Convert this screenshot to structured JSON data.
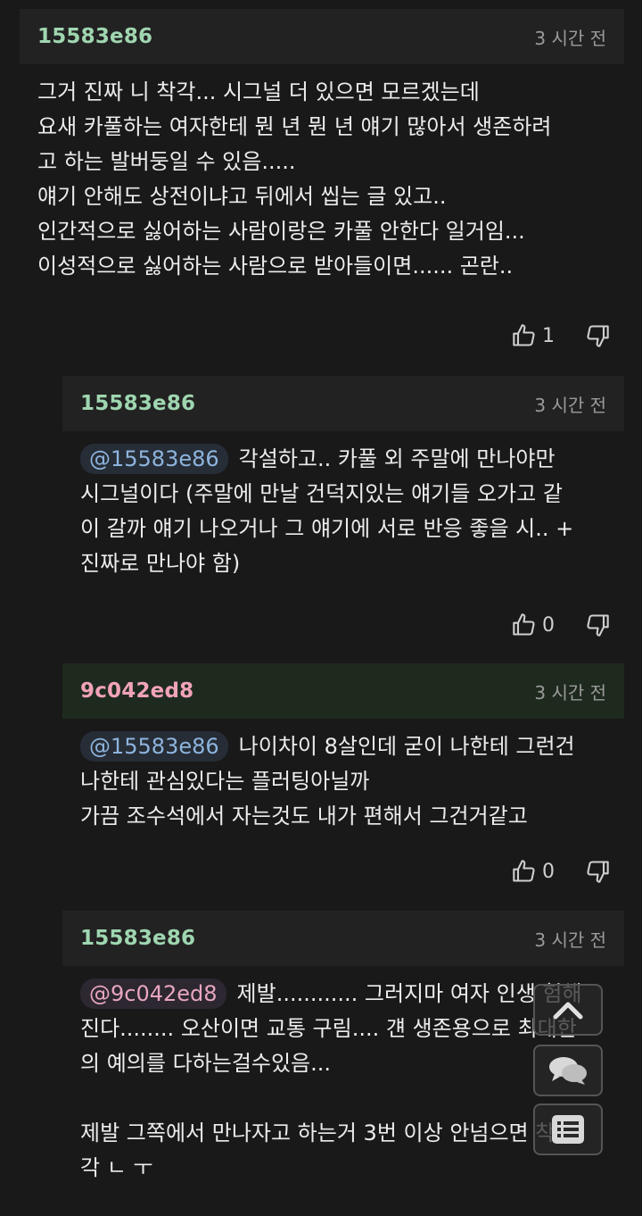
{
  "comments": [
    {
      "user": "15583e86",
      "time": "3 시간 전",
      "mention": "",
      "text": "그거 진짜 니 착각... 시그널 더 있으면 모르겠는데\n요새 카풀하는 여자한테 뭔 년 뭔 년 얘기 많아서 생존하려\n고 하는 발버둥일 수 있음.....\n얘기 안해도 상전이냐고 뒤에서 씹는 글 있고..\n인간적으로 싫어하는 사람이랑은 카풀 안한다 일거임...\n이성적으로 싫어하는 사람으로 받아들이면...... 곤란..",
      "likes": "1"
    },
    {
      "user": "15583e86",
      "time": "3 시간 전",
      "mention": "@15583e86",
      "text": "각설하고.. 카풀 외 주말에 만나야만\n시그널이다 (주말에 만날 건덕지있는 얘기들 오가고 같\n이 갈까 얘기 나오거나 그 얘기에 서로 반응 좋을 시.. +\n진짜로 만나야 함)",
      "likes": "0"
    },
    {
      "user": "9c042ed8",
      "time": "3 시간 전",
      "mention": "@15583e86",
      "text": "나이차이 8살인데 굳이 나한테 그런건\n나한테 관심있다는 플러팅아닐까\n가끔 조수석에서 자는것도 내가 편해서 그건거같고",
      "likes": "0"
    },
    {
      "user": "15583e86",
      "time": "3 시간 전",
      "mention": "@9c042ed8",
      "text": "제발............ 그러지마 여자 인생 험해\n진다........ 오산이면 교통 구림.... 걘 생존용으로 최대한\n의 예의를 다하는걸수있음...\n\n제발 그쪽에서 만나자고 하는거 3번 이상 안넘으면 착\n각 ㄴ ㅜ",
      "likes": ""
    }
  ],
  "floating_buttons": [
    "chevron-up-icon",
    "chat-bubbles-icon",
    "list-icon"
  ]
}
